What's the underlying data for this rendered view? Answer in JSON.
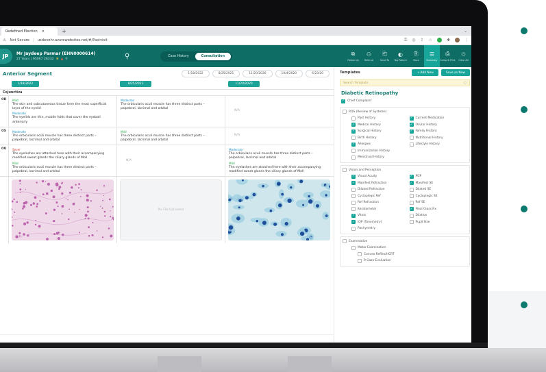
{
  "browser": {
    "tab_title": "Redefined Election",
    "new_tab": "+",
    "url_security": "Not Secure",
    "url": "usdevehr.azurewebsites.net/#/Pastvisit"
  },
  "header": {
    "avatar": "JP",
    "patient_name": "Mr Jaydeep Parmar (EHN0000614)",
    "patient_meta": "27 Years | 95067 26332",
    "tabs": [
      {
        "label": "Case History",
        "active": false
      },
      {
        "label": "Consultation",
        "active": true
      }
    ],
    "icons": [
      {
        "label": "Follow Up",
        "icon": "calendar-icon",
        "glyph": "⧉"
      },
      {
        "label": "Referral",
        "icon": "users-icon",
        "glyph": "⚇"
      },
      {
        "label": "Send To",
        "icon": "send-icon",
        "glyph": "⎗"
      },
      {
        "label": "Tag Patient",
        "icon": "tag-icon",
        "glyph": "◐"
      },
      {
        "label": "Docs",
        "icon": "docs-icon",
        "glyph": "⎘"
      },
      {
        "label": "Summary",
        "icon": "summary-icon",
        "glyph": "☰",
        "active": true
      },
      {
        "label": "Comp & Print",
        "icon": "print-icon",
        "glyph": "⎙"
      },
      {
        "label": "Clear All",
        "icon": "trash-icon",
        "glyph": "♲"
      }
    ]
  },
  "anterior": {
    "title": "Anterior Segment",
    "date_chips": [
      "1/18/2022",
      "8/25/2021",
      "11/20/2020",
      "10/4/2020",
      "6/23/20"
    ],
    "columns": [
      "1/18/2022",
      "8/25/2021",
      "11/20/2020"
    ],
    "section": "Cojunctiva",
    "rows": [
      {
        "eye": "OD",
        "cells": [
          {
            "items": [
              {
                "sev": "Mild",
                "cls": "mild",
                "text": "The skin and subcutaneous tissue form the most superficial layer of the eyelid"
              },
              {
                "sev": "Moderate",
                "cls": "mod",
                "text": "The eyelids are thin, mobile folds that cover the eyeball anteriorly"
              }
            ]
          },
          {
            "items": [
              {
                "sev": "Moderate",
                "cls": "mod",
                "text": "The orbicularis oculi muscle has three distinct parts – palpebral, lacrimal and orbital"
              }
            ]
          },
          {
            "na": "N/A"
          }
        ]
      },
      {
        "eye": "OS",
        "cells": [
          {
            "items": [
              {
                "sev": "Moderate",
                "cls": "mod",
                "text": "The orbicularis oculi muscle has three distinct parts – palpebral, lacrimal and orbital"
              }
            ]
          },
          {
            "items": [
              {
                "sev": "Mild",
                "cls": "mild",
                "text": "The orbicularis oculi muscle has three distinct parts – palpebral, lacrimal and orbital"
              }
            ]
          },
          {
            "na": "N/A"
          }
        ]
      },
      {
        "eye": "OU",
        "cells": [
          {
            "items": [
              {
                "sev": "Sever",
                "cls": "sevr",
                "text": "The eyelashes are attached here with their accompanying modified sweat glands the ciliary glands of Moll"
              },
              {
                "sev": "Mild",
                "cls": "mild",
                "text": "The orbicularis oculi muscle has three distinct parts – palpebral, lacrimal and orbital"
              }
            ]
          },
          {
            "na": "N/A"
          },
          {
            "items": [
              {
                "sev": "Moderate",
                "cls": "mod",
                "text": "The orbicularis oculi muscle has three distinct parts – palpebral, lacrimal and orbital"
              },
              {
                "sev": "Mild",
                "cls": "mild",
                "text": "The eyelashes are attached here with their accompanying modified sweat glands the ciliary glands of Moll"
              }
            ]
          }
        ]
      }
    ],
    "no_file": "No File Uploaded"
  },
  "templates": {
    "title": "Templates",
    "add_new": "+  Add New",
    "save_as_new": "Save as New",
    "search_placeholder": "Search Template",
    "condition": "Diabetic Retinopathy",
    "chief": {
      "label": "Chief Complaint",
      "on": true
    },
    "ros": {
      "label": "ROS (Review of Systems)",
      "on": false,
      "items": [
        {
          "label": "Past History",
          "on": false
        },
        {
          "label": "Current Medication",
          "on": true
        },
        {
          "label": "Medical History",
          "on": true
        },
        {
          "label": "Ocular History",
          "on": true
        },
        {
          "label": "Surgical History",
          "on": true
        },
        {
          "label": "Family History",
          "on": true
        },
        {
          "label": "Birth History",
          "on": false
        },
        {
          "label": "Nutritional History",
          "on": false
        },
        {
          "label": "Allergies",
          "on": true
        },
        {
          "label": "Lifestyle History",
          "on": false
        }
      ],
      "extra": [
        {
          "label": "Immunization History",
          "on": false
        },
        {
          "label": "Menstrual History",
          "on": false
        }
      ]
    },
    "vision": {
      "label": "Vision and Perception",
      "on": false,
      "items": [
        {
          "label": "Visual Acuity",
          "on": true
        },
        {
          "label": "PGP",
          "on": true
        },
        {
          "label": "Manifest Refraction",
          "on": true
        },
        {
          "label": "Manifest SE",
          "on": true
        },
        {
          "label": "Dilated Refraction",
          "on": false
        },
        {
          "label": "Dilated SE",
          "on": false
        },
        {
          "label": "Cycloplegic Ref",
          "on": false
        },
        {
          "label": "Cycloplegic SE",
          "on": false
        },
        {
          "label": "Ref Refraction",
          "on": false
        },
        {
          "label": "Ref SE",
          "on": false
        },
        {
          "label": "Keratometer",
          "on": false
        },
        {
          "label": "Final Glass Rx",
          "on": true
        },
        {
          "label": "Vitals",
          "on": true
        },
        {
          "label": "Dilation",
          "on": false
        },
        {
          "label": "IOP (Tonometry)",
          "on": true
        },
        {
          "label": "Pupil Size",
          "on": false
        }
      ],
      "extra": [
        {
          "label": "Pachymetry",
          "on": false
        }
      ]
    },
    "exam": {
      "label": "Examination",
      "on": false,
      "items": [
        {
          "label": "Motor Examination",
          "on": false
        }
      ],
      "sub": [
        {
          "label": "Convex Reflex/HCRT",
          "on": false
        },
        {
          "label": "9 Gaze Evaluation",
          "on": false
        }
      ]
    }
  },
  "colors": {
    "brand": "#0e6e66",
    "accent": "#19a69a",
    "bullet": "#0c7a6e"
  }
}
